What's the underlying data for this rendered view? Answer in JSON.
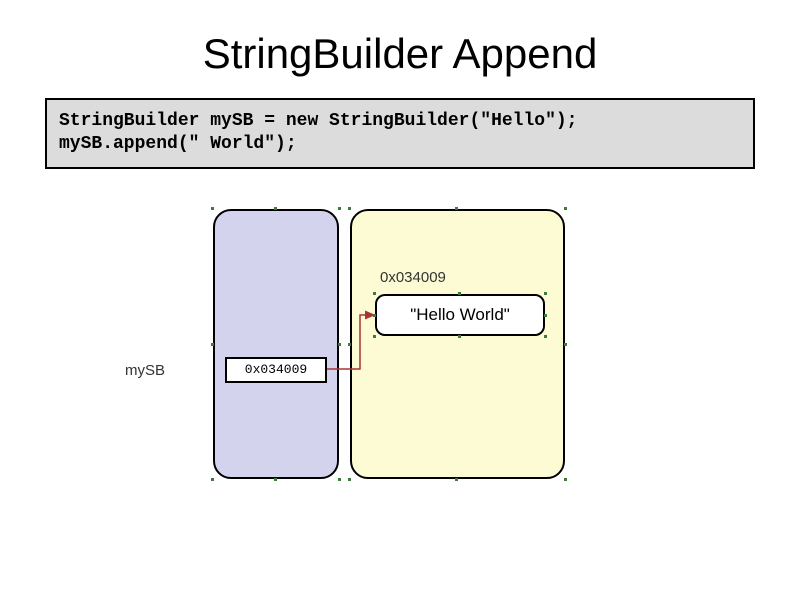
{
  "title": "StringBuilder Append",
  "code": "StringBuilder mySB = new StringBuilder(\"Hello\");\nmySB.append(\" World\");",
  "diagram": {
    "varLabel": "mySB",
    "pointerValue": "0x034009",
    "heapAddress": "0x034009",
    "objectValue": "\"Hello World\""
  },
  "colors": {
    "stack": "#d3d3ee",
    "heap": "#fdfbd4",
    "codeBg": "#dcdcdc",
    "arrow": "#aa3333"
  }
}
